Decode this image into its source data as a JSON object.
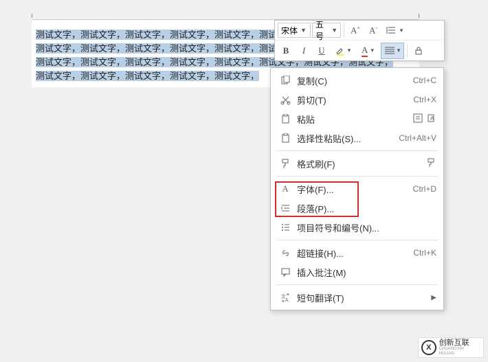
{
  "document": {
    "lines": [
      "测试文字，测试文字，测试文字，测试文字，测试文字，测试文字，测试文字，测试文字，",
      "测试文字，测试文字，测试文字，测试文字，测试文字，测试文字，测试文字，测试文字，",
      "测试文字，测试文字，测试文字，测试文字，测试文字，测试文字，测试文字，测试文字，",
      "测试文字，测试文字，测试文字，测试文字，测试文字，"
    ]
  },
  "toolbar": {
    "font_name": "宋体",
    "font_size": "五号"
  },
  "menu": {
    "copy": "复制(C)",
    "copy_sc": "Ctrl+C",
    "cut": "剪切(T)",
    "cut_sc": "Ctrl+X",
    "paste": "粘贴",
    "paste_special": "选择性粘贴(S)...",
    "paste_special_sc": "Ctrl+Alt+V",
    "format_painter": "格式刷(F)",
    "font": "字体(F)...",
    "font_sc": "Ctrl+D",
    "paragraph": "段落(P)...",
    "bullets": "项目符号和编号(N)...",
    "hyperlink": "超链接(H)...",
    "hyperlink_sc": "Ctrl+K",
    "comment": "插入批注(M)",
    "translate": "短句翻译(T)"
  },
  "watermark": {
    "logo": "X",
    "text": "创新互联"
  }
}
